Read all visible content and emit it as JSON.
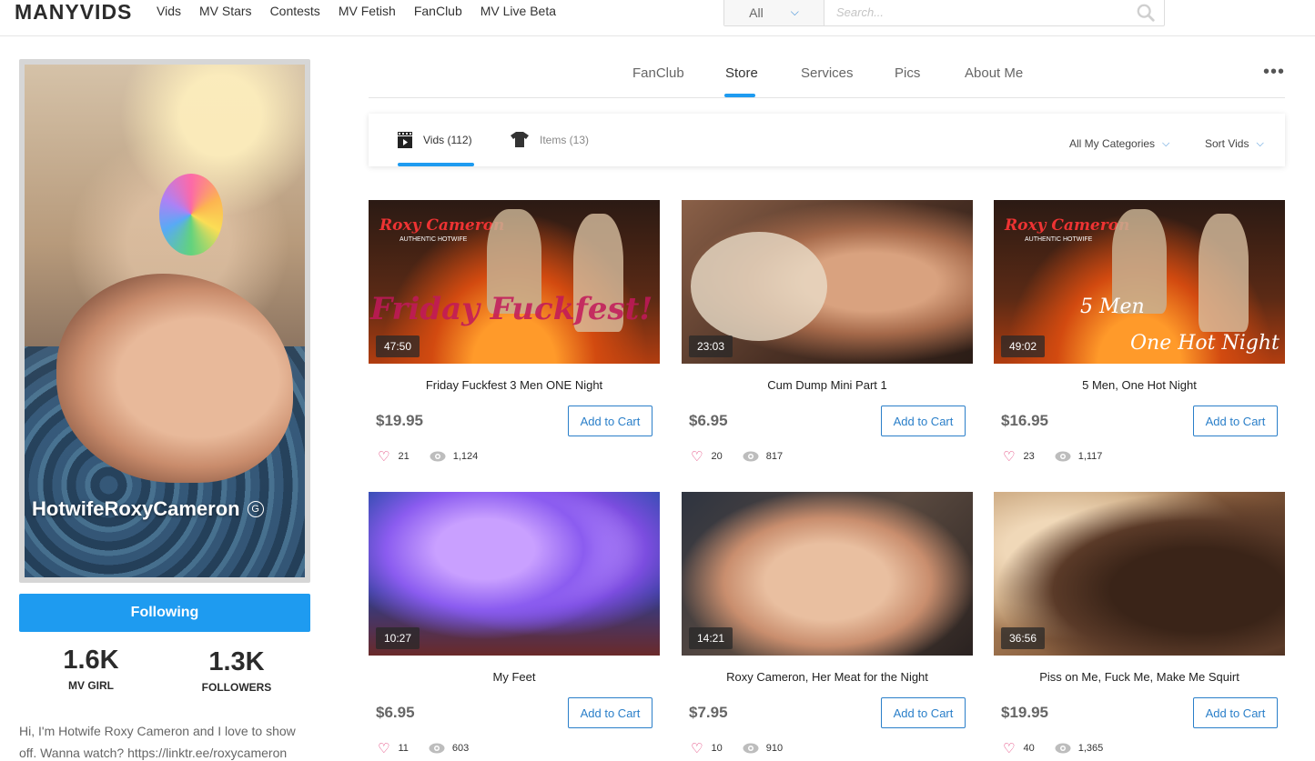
{
  "header": {
    "logo": "MANYVIDS",
    "nav": [
      "Vids",
      "MV Stars",
      "Contests",
      "MV Fetish",
      "FanClub",
      "MV Live Beta"
    ],
    "search": {
      "category": "All",
      "placeholder": "Search..."
    }
  },
  "profile": {
    "name": "HotwifeRoxyCameron",
    "badge": "G",
    "follow_label": "Following",
    "stats": [
      {
        "value": "1.6K",
        "label": "MV GIRL"
      },
      {
        "value": "1.3K",
        "label": "FOLLOWERS"
      }
    ],
    "bio": "Hi, I'm Hotwife Roxy Cameron and I love to show off. Wanna watch? https://linktr.ee/roxycameron"
  },
  "profile_tabs": [
    "FanClub",
    "Store",
    "Services",
    "Pics",
    "About Me"
  ],
  "profile_tabs_active": "Store",
  "store": {
    "tabs": [
      {
        "label": "Vids (112)",
        "icon": "film-icon"
      },
      {
        "label": "Items (13)",
        "icon": "tshirt-icon"
      }
    ],
    "category_filter": "All My Categories",
    "sort": "Sort Vids",
    "add_to_cart_label": "Add to Cart"
  },
  "videos": [
    {
      "title": "Friday Fuckfest 3 Men ONE Night",
      "duration": "47:50",
      "price": "$19.95",
      "likes": "21",
      "views": "1,124"
    },
    {
      "title": "Cum Dump Mini Part 1",
      "duration": "23:03",
      "price": "$6.95",
      "likes": "20",
      "views": "817"
    },
    {
      "title": "5 Men, One Hot Night",
      "duration": "49:02",
      "price": "$16.95",
      "likes": "23",
      "views": "1,117"
    },
    {
      "title": "My Feet",
      "duration": "10:27",
      "price": "$6.95",
      "likes": "11",
      "views": "603"
    },
    {
      "title": "Roxy Cameron, Her Meat for the Night",
      "duration": "14:21",
      "price": "$7.95",
      "likes": "10",
      "views": "910"
    },
    {
      "title": "Piss on Me, Fuck Me, Make Me Squirt",
      "duration": "36:56",
      "price": "$19.95",
      "likes": "40",
      "views": "1,365"
    }
  ],
  "thumb_overlays": {
    "v0": {
      "brand": "Roxy Cameron",
      "tagline": "AUTHENTIC HOTWIFE",
      "big": "Friday Fuckfest!"
    },
    "v2": {
      "brand": "Roxy Cameron",
      "tagline": "AUTHENTIC HOTWIFE",
      "line1": "5 Men",
      "line2": "One Hot Night"
    }
  },
  "colors": {
    "accent": "#1e9bf0",
    "link": "#2a7fc9",
    "heart": "#e0316f"
  }
}
